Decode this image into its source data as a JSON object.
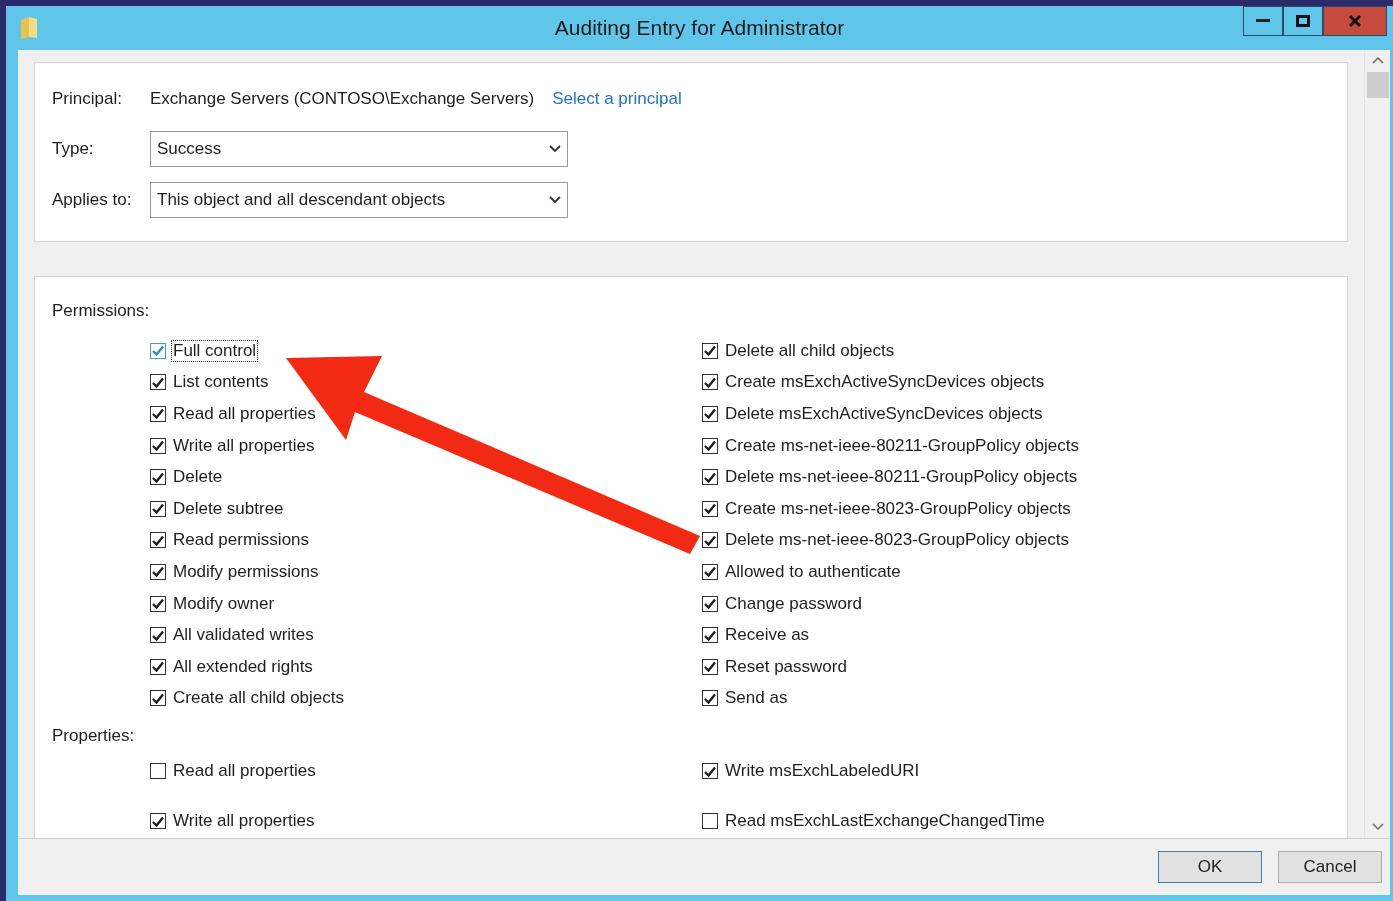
{
  "window": {
    "title": "Auditing Entry for Administrator"
  },
  "principal": {
    "label": "Principal:",
    "value": "Exchange Servers (CONTOSO\\Exchange Servers)",
    "link": "Select a principal"
  },
  "type": {
    "label": "Type:",
    "value": "Success"
  },
  "applies_to": {
    "label": "Applies to:",
    "value": "This object and all descendant objects"
  },
  "permissions": {
    "label": "Permissions:",
    "left": [
      {
        "label": "Full control",
        "checked": true,
        "focused": true
      },
      {
        "label": "List contents",
        "checked": true,
        "focused": false
      },
      {
        "label": "Read all properties",
        "checked": true,
        "focused": false
      },
      {
        "label": "Write all properties",
        "checked": true,
        "focused": false
      },
      {
        "label": "Delete",
        "checked": true,
        "focused": false
      },
      {
        "label": "Delete subtree",
        "checked": true,
        "focused": false
      },
      {
        "label": "Read permissions",
        "checked": true,
        "focused": false
      },
      {
        "label": "Modify permissions",
        "checked": true,
        "focused": false
      },
      {
        "label": "Modify owner",
        "checked": true,
        "focused": false
      },
      {
        "label": "All validated writes",
        "checked": true,
        "focused": false
      },
      {
        "label": "All extended rights",
        "checked": true,
        "focused": false
      },
      {
        "label": "Create all child objects",
        "checked": true,
        "focused": false
      }
    ],
    "right": [
      {
        "label": "Delete all child objects",
        "checked": true,
        "focused": false
      },
      {
        "label": "Create msExchActiveSyncDevices objects",
        "checked": true,
        "focused": false
      },
      {
        "label": "Delete msExchActiveSyncDevices objects",
        "checked": true,
        "focused": false
      },
      {
        "label": "Create ms-net-ieee-80211-GroupPolicy objects",
        "checked": true,
        "focused": false
      },
      {
        "label": "Delete ms-net-ieee-80211-GroupPolicy objects",
        "checked": true,
        "focused": false
      },
      {
        "label": "Create ms-net-ieee-8023-GroupPolicy objects",
        "checked": true,
        "focused": false
      },
      {
        "label": "Delete ms-net-ieee-8023-GroupPolicy objects",
        "checked": true,
        "focused": false
      },
      {
        "label": "Allowed to authenticate",
        "checked": true,
        "focused": false
      },
      {
        "label": "Change password",
        "checked": true,
        "focused": false
      },
      {
        "label": "Receive as",
        "checked": true,
        "focused": false
      },
      {
        "label": "Reset password",
        "checked": true,
        "focused": false
      },
      {
        "label": "Send as",
        "checked": true,
        "focused": false
      }
    ]
  },
  "properties": {
    "label": "Properties:",
    "left": [
      {
        "label": "Read all properties",
        "checked": false,
        "focused": false
      },
      {
        "label": "Write all properties",
        "checked": true,
        "focused": false
      }
    ],
    "right": [
      {
        "label": "Write msExchLabeledURI",
        "checked": true,
        "focused": false
      },
      {
        "label": "Read msExchLastExchangeChangedTime",
        "checked": false,
        "focused": false
      }
    ]
  },
  "buttons": [
    "OK",
    "Cancel"
  ]
}
